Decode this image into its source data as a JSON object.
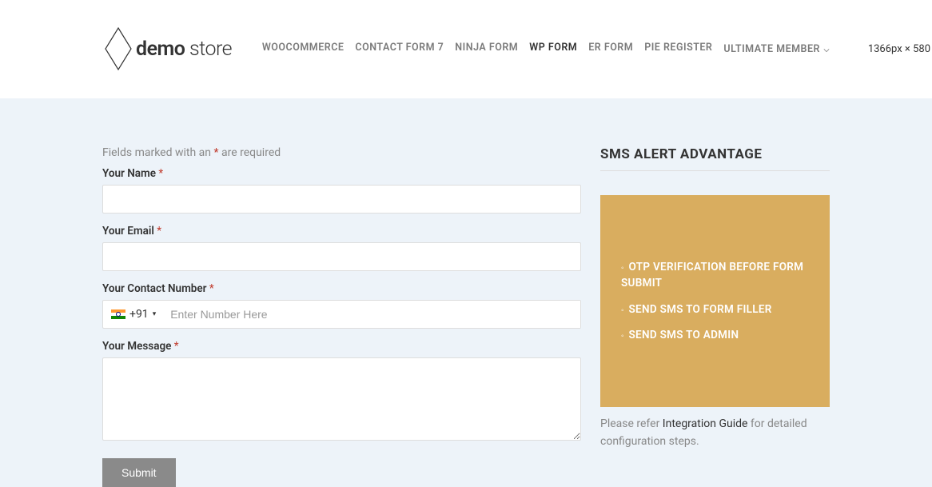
{
  "dimensions_label": "1366px × 580",
  "logo": {
    "text_bold": "demo",
    "text_light": " store"
  },
  "nav": {
    "items": [
      {
        "label": "WOOCOMMERCE",
        "active": false
      },
      {
        "label": "CONTACT FORM 7",
        "active": false
      },
      {
        "label": "NINJA FORM",
        "active": false
      },
      {
        "label": "WP FORM",
        "active": true
      },
      {
        "label": "ER FORM",
        "active": false
      },
      {
        "label": "PIE REGISTER",
        "active": false
      },
      {
        "label": "ULTIMATE MEMBER",
        "active": false,
        "has_dropdown": true
      }
    ]
  },
  "form": {
    "required_note_prefix": "Fields marked with an ",
    "required_note_asterisk": "*",
    "required_note_suffix": " are required",
    "name_label": "Your Name ",
    "email_label": "Your Email ",
    "phone_label": "Your Contact Number ",
    "message_label": "Your Message ",
    "asterisk": "*",
    "country_code": "+91",
    "phone_placeholder": "Enter Number Here",
    "submit_label": "Submit"
  },
  "sidebar": {
    "title": "SMS ALERT ADVANTAGE",
    "advantages": [
      "OTP VERIFICATION BEFORE FORM SUBMIT",
      "SEND SMS TO FORM FILLER",
      "SEND SMS TO ADMIN"
    ],
    "refer_prefix": "Please refer ",
    "refer_link": "Integration Guide",
    "refer_suffix": " for detailed configuration steps."
  }
}
